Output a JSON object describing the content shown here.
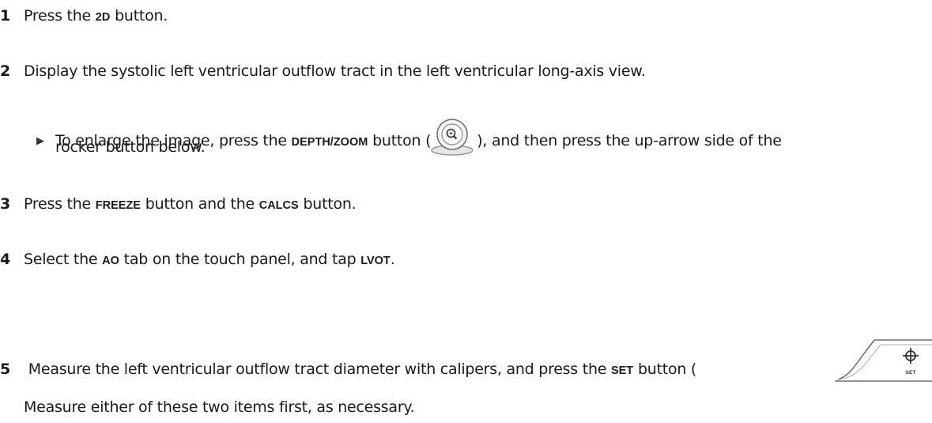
{
  "steps": [
    {
      "number": "1",
      "parts": [
        "Press the ",
        "2D",
        " button."
      ]
    },
    {
      "number": "2",
      "text": "Display the systolic left ventricular outflow tract in the left ventricular long-axis view."
    },
    {
      "bullet": {
        "marker": "▶",
        "parts": [
          "To enlarge the image, press the ",
          "DEPTH/ZOOM",
          " button (",
          "), and then press the up-arrow side of the"
        ],
        "continuation": "rocker button below."
      }
    },
    {
      "number": "3",
      "parts": [
        "Press the ",
        "FREEZE",
        " button and the ",
        "CALCS",
        " button."
      ]
    },
    {
      "number": "4",
      "parts": [
        "Select the ",
        "AO",
        " tab on the touch panel, and tap ",
        "LVOT",
        "."
      ]
    },
    {
      "number": "5",
      "parts": [
        " Measure the left ventricular outflow tract diameter with calipers, and press the ",
        "SET",
        " button ("
      ]
    }
  ],
  "note": "Measure either of these two items first, as necessary.",
  "icons": {
    "zoom": "depth-zoom-knob-icon",
    "set": "set-crosshair-button-icon",
    "set_label": "SET"
  }
}
